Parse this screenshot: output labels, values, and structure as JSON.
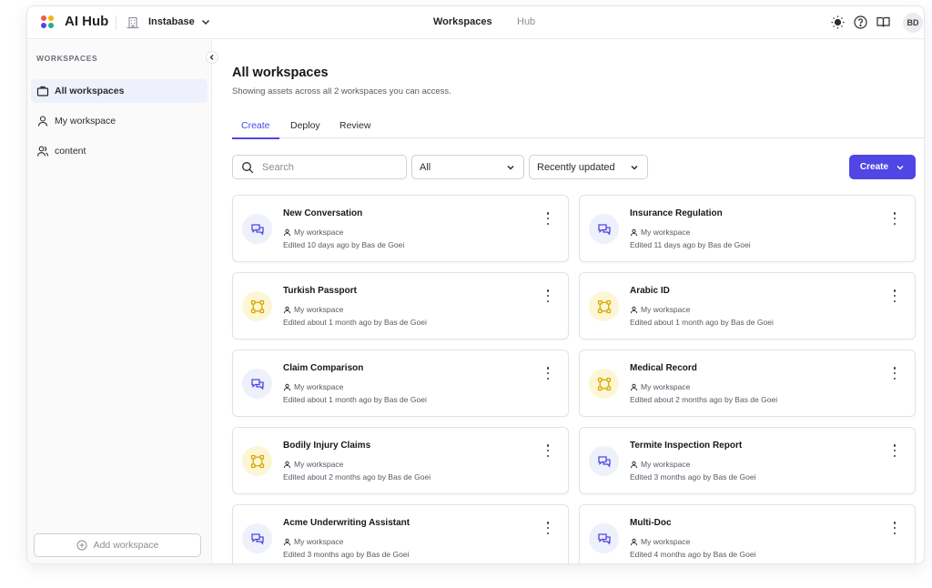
{
  "app": {
    "name": "AI Hub",
    "org": "Instabase"
  },
  "nav": {
    "workspaces": "Workspaces",
    "hub": "Hub"
  },
  "user": {
    "initials": "BD"
  },
  "icons": {
    "theme": "sun-icon",
    "help": "help-circle-icon",
    "docs": "book-open-icon"
  },
  "colors": {
    "accent": "#4f46e5",
    "flow_bg": "#fdf6d6",
    "flow_fg": "#e0b400",
    "chat_bg": "#eef0fb"
  },
  "sidebar": {
    "heading": "WORKSPACES",
    "items": [
      {
        "label": "All workspaces",
        "icon": "briefcase-icon"
      },
      {
        "label": "My workspace",
        "icon": "user-icon"
      },
      {
        "label": "content",
        "icon": "users-icon"
      }
    ],
    "add_label": "Add workspace"
  },
  "main": {
    "title": "All workspaces",
    "subtitle": "Showing assets across all 2 workspaces you can access.",
    "tabs": [
      {
        "label": "Create"
      },
      {
        "label": "Deploy"
      },
      {
        "label": "Review"
      }
    ],
    "search_placeholder": "Search",
    "filter_value": "All",
    "sort_value": "Recently updated",
    "create_label": "Create"
  },
  "cards": [
    {
      "title": "New Conversation",
      "type": "chat",
      "workspace": "My workspace",
      "edited": "Edited 10 days ago by Bas de Goei"
    },
    {
      "title": "Insurance Regulation",
      "type": "chat",
      "workspace": "My workspace",
      "edited": "Edited 11 days ago by Bas de Goei"
    },
    {
      "title": "Turkish Passport",
      "type": "flow",
      "workspace": "My workspace",
      "edited": "Edited about 1 month ago by Bas de Goei"
    },
    {
      "title": "Arabic ID",
      "type": "flow",
      "workspace": "My workspace",
      "edited": "Edited about 1 month ago by Bas de Goei"
    },
    {
      "title": "Claim Comparison",
      "type": "chat",
      "workspace": "My workspace",
      "edited": "Edited about 1 month ago by Bas de Goei"
    },
    {
      "title": "Medical Record",
      "type": "flow",
      "workspace": "My workspace",
      "edited": "Edited about 2 months ago by Bas de Goei"
    },
    {
      "title": "Bodily Injury Claims",
      "type": "flow",
      "workspace": "My workspace",
      "edited": "Edited about 2 months ago by Bas de Goei"
    },
    {
      "title": "Termite Inspection Report",
      "type": "chat",
      "workspace": "My workspace",
      "edited": "Edited 3 months ago by Bas de Goei"
    },
    {
      "title": "Acme Underwriting Assistant",
      "type": "chat",
      "workspace": "My workspace",
      "edited": "Edited 3 months ago by Bas de Goei"
    },
    {
      "title": "Multi-Doc",
      "type": "chat",
      "workspace": "My workspace",
      "edited": "Edited 4 months ago by Bas de Goei"
    }
  ]
}
